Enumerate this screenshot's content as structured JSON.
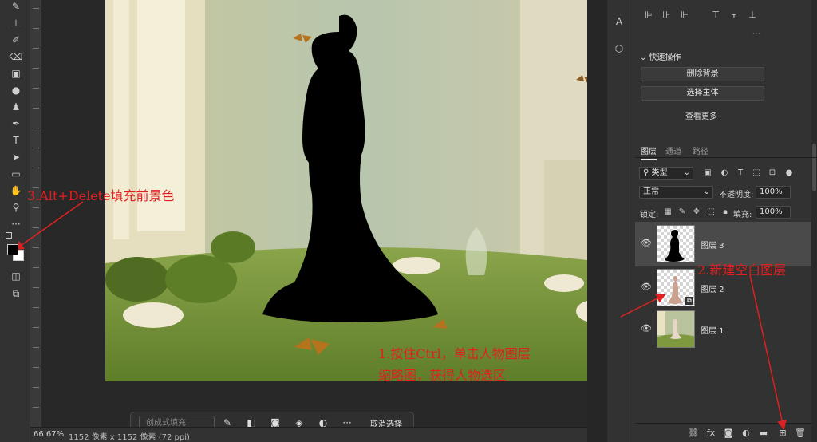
{
  "toolbar": {
    "tools": [
      {
        "icon": "brush-icon",
        "glyph": "✎"
      },
      {
        "icon": "stamp-icon",
        "glyph": "⊥"
      },
      {
        "icon": "history-brush-icon",
        "glyph": "✐"
      },
      {
        "icon": "eraser-icon",
        "glyph": "⌫"
      },
      {
        "icon": "gradient-icon",
        "glyph": "▣"
      },
      {
        "icon": "blur-icon",
        "glyph": "●"
      },
      {
        "icon": "dodge-icon",
        "glyph": "♟"
      },
      {
        "icon": "pen-icon",
        "glyph": "✒"
      },
      {
        "icon": "type-icon",
        "glyph": "T"
      },
      {
        "icon": "path-select-icon",
        "glyph": "➤"
      },
      {
        "icon": "rectangle-icon",
        "glyph": "▭"
      },
      {
        "icon": "hand-icon",
        "glyph": "✋"
      },
      {
        "icon": "zoom-icon",
        "glyph": "⚲"
      },
      {
        "icon": "more-tools-icon",
        "glyph": "···"
      }
    ],
    "foreground_color": "#000000",
    "background_color": "#ffffff"
  },
  "statusbar": {
    "zoom": "66.67%",
    "doc_size": "1152 像素 x 1152 像素 (72 ppi)"
  },
  "context_bar": {
    "generative_fill_label": "创成式填充",
    "deselect_label": "取消选择"
  },
  "quick_actions": {
    "title": "快速操作",
    "buttons": [
      "删除背景",
      "选择主体"
    ],
    "more_link": "查看更多"
  },
  "layers_panel": {
    "tabs": [
      "图层",
      "通道",
      "路径"
    ],
    "filter_kind": "类型",
    "blend_mode": "正常",
    "opacity_label": "不透明度:",
    "opacity_value": "100%",
    "lock_label": "锁定:",
    "fill_label": "填充:",
    "fill_value": "100%",
    "layers": [
      {
        "name": "图层 3",
        "selected": true
      },
      {
        "name": "图层 2",
        "selected": false
      },
      {
        "name": "图层 1",
        "selected": false
      }
    ]
  },
  "annotations": {
    "step1_line1": "1.按住Ctrl，单击人物图层",
    "step1_line2": "缩略图，获得人物选区",
    "step2": "2.新建空白图层",
    "step3": "3.Alt+Delete填充前景色"
  },
  "colors": {
    "annotation_red": "#e02020",
    "panel_bg": "#323232",
    "selected_row": "#4a4a4a"
  }
}
